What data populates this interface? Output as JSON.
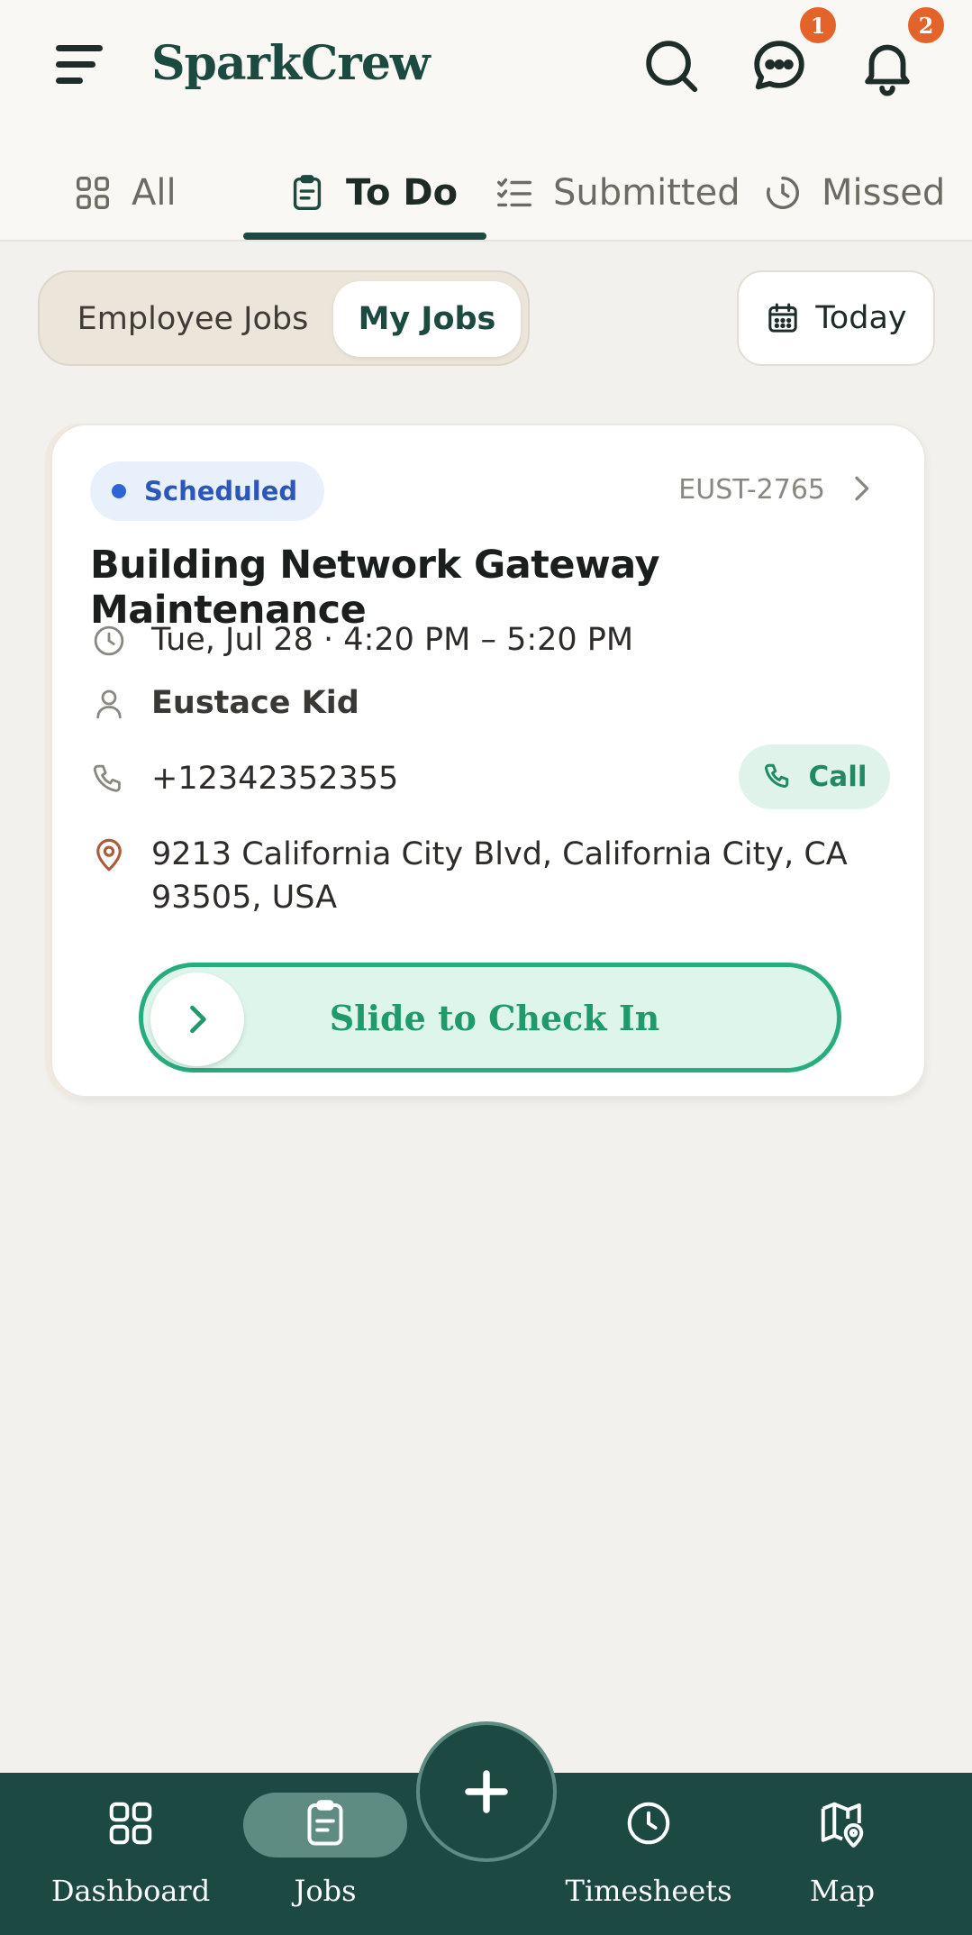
{
  "header": {
    "brand": "SparkCrew",
    "messages_badge": "1",
    "notifications_badge": "2",
    "icons": [
      "menu-icon",
      "search-icon",
      "chat-icon",
      "bell-icon"
    ]
  },
  "tabs": [
    {
      "label": "All",
      "icon": "grid-icon",
      "active": false
    },
    {
      "label": "To Do",
      "icon": "clipboard-icon",
      "active": true
    },
    {
      "label": "Submitted",
      "icon": "checklist-icon",
      "active": false
    },
    {
      "label": "Missed",
      "icon": "clock-icon",
      "active": false
    }
  ],
  "filters": {
    "segment_options": [
      "Employee Jobs",
      "My Jobs"
    ],
    "selected_segment": "My Jobs",
    "date_button": "Today"
  },
  "job_card": {
    "status": "Scheduled",
    "code": "EUST-2765",
    "title": "Building Network Gateway Maintenance",
    "datetime": "Tue, Jul 28 · 4:20 PM – 5:20 PM",
    "customer": "Eustace Kid",
    "phone": "+12342352355",
    "call_label": "Call",
    "address": "9213 California City Blvd, California City, CA 93505, USA",
    "slider_label": "Slide to Check In"
  },
  "bottom_nav": {
    "items": [
      {
        "label": "Dashboard",
        "icon": "grid-icon"
      },
      {
        "label": "Jobs",
        "icon": "clipboard-icon",
        "active": true
      },
      {
        "label": "Timesheets",
        "icon": "clock-icon"
      },
      {
        "label": "Map",
        "icon": "map-pin-icon"
      }
    ],
    "fab_icon": "plus-icon"
  },
  "colors": {
    "brand": "#1c4a40",
    "nav_bg": "#1c4a43",
    "badge": "#e3632a",
    "status_blue": "#2c56b8",
    "success_green": "#26ad7d",
    "background": "#f3f1ed"
  }
}
